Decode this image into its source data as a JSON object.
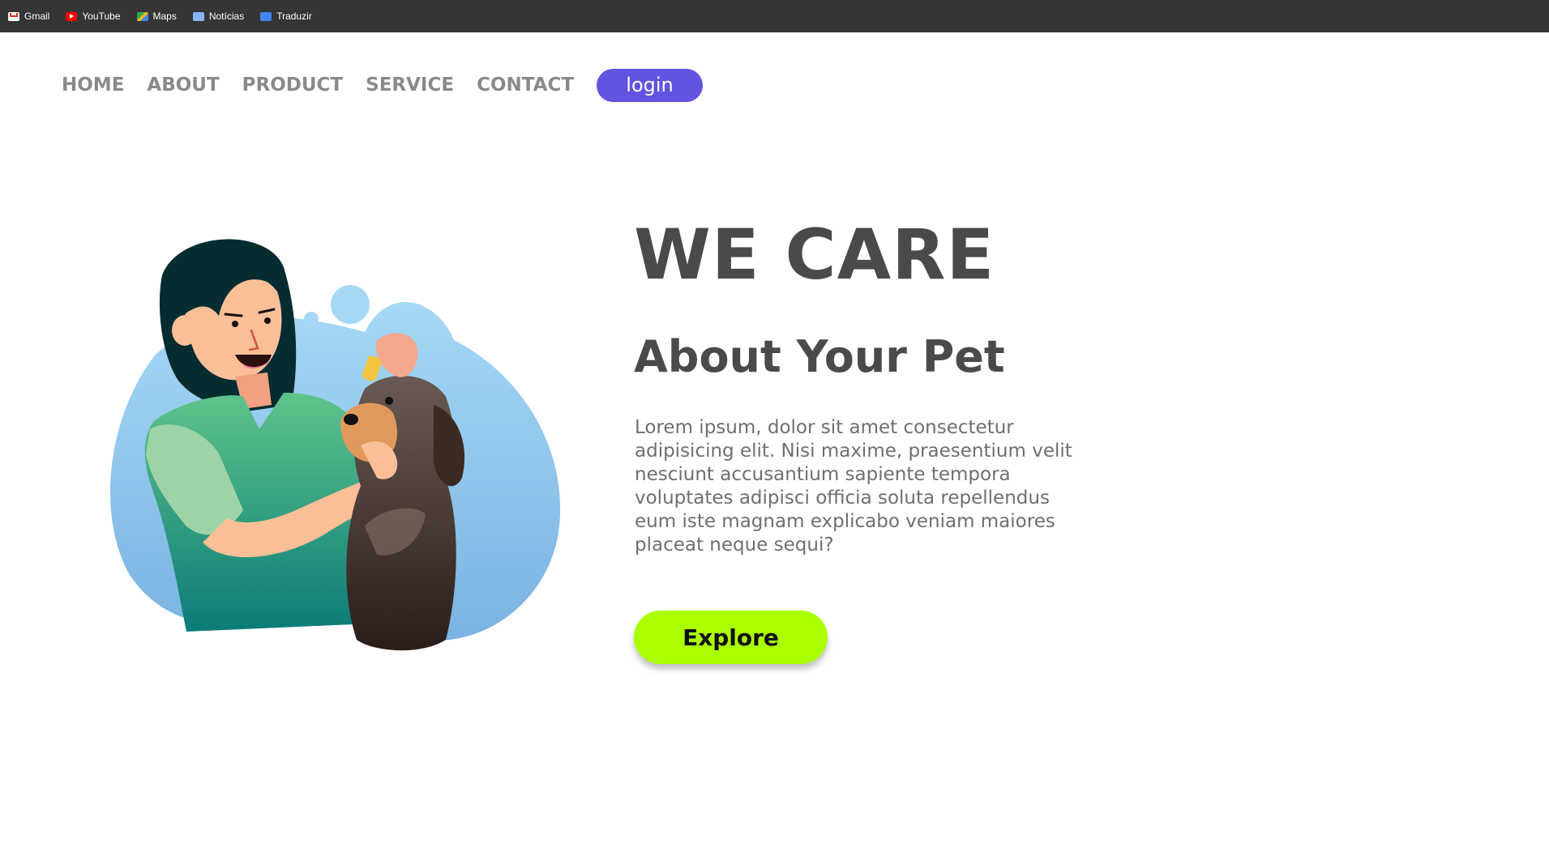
{
  "bookmarks": [
    {
      "label": "Gmail",
      "icon": "gmail-icon"
    },
    {
      "label": "YouTube",
      "icon": "youtube-icon"
    },
    {
      "label": "Maps",
      "icon": "maps-icon"
    },
    {
      "label": "Notícias",
      "icon": "news-icon"
    },
    {
      "label": "Traduzir",
      "icon": "translate-icon"
    }
  ],
  "nav": {
    "items": [
      "HOME",
      "ABOUT",
      "PRODUCT",
      "SERVICE",
      "CONTACT"
    ],
    "login_label": "login"
  },
  "hero": {
    "headline": "WE CARE",
    "subheadline": "About Your Pet",
    "paragraph": "Lorem ipsum, dolor sit amet consectetur adipisicing elit. Nisi maxime, praesentium velit nesciunt accusantium sapiente tempora voluptates adipisci officia soluta repellendus eum iste magnam explicabo veniam maiores placeat neque sequi?",
    "cta_label": "Explore"
  },
  "colors": {
    "topbar": "#353535",
    "nav_text": "#8a8a8a",
    "login_bg": "#6253e1",
    "heading": "#4a4a4a",
    "body_text": "#6f6f6f",
    "cta_bg": "#aaff00"
  }
}
